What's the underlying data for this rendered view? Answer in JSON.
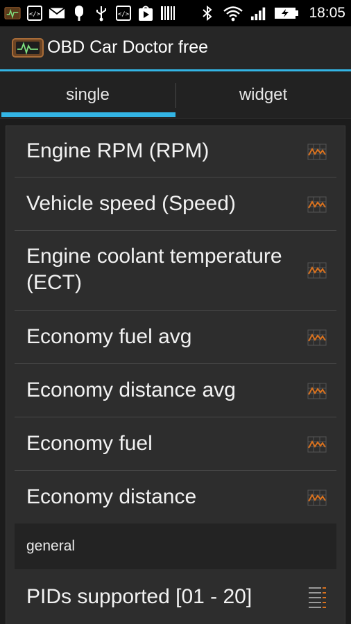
{
  "status_bar": {
    "time": "18:05",
    "left_icons": [
      "app-notification-icon",
      "code-icon",
      "mail-icon",
      "popsicle-icon",
      "usb-icon",
      "code-icon",
      "play-store-icon",
      "barcode-icon"
    ],
    "right_icons": [
      "bluetooth-icon",
      "wifi-icon",
      "signal-icon",
      "battery-icon"
    ]
  },
  "action_bar": {
    "title": "OBD Car Doctor free",
    "icon": "car-doctor-logo-icon"
  },
  "tabs": [
    {
      "label": "single",
      "selected": true
    },
    {
      "label": "widget",
      "selected": false
    }
  ],
  "list": {
    "items": [
      {
        "label_lines": [
          "Engine RPM (RPM)"
        ],
        "icon": "graph-icon"
      },
      {
        "label_lines": [
          "Vehicle speed (Speed)"
        ],
        "icon": "graph-icon"
      },
      {
        "label_lines": [
          "Engine coolant temperature",
          "(ECT)"
        ],
        "icon": "graph-icon"
      },
      {
        "label_lines": [
          "Economy fuel avg"
        ],
        "icon": "graph-icon"
      },
      {
        "label_lines": [
          "Economy distance avg"
        ],
        "icon": "graph-icon"
      },
      {
        "label_lines": [
          "Economy fuel"
        ],
        "icon": "graph-icon"
      },
      {
        "label_lines": [
          "Economy distance"
        ],
        "icon": "graph-icon"
      }
    ],
    "section_header": "general",
    "general_items": [
      {
        "label_lines": [
          "PIDs supported [01 - 20]"
        ],
        "icon": "list-icon"
      }
    ]
  },
  "colors": {
    "accent": "#33b5e5",
    "graph_orange": "#d9721f"
  }
}
